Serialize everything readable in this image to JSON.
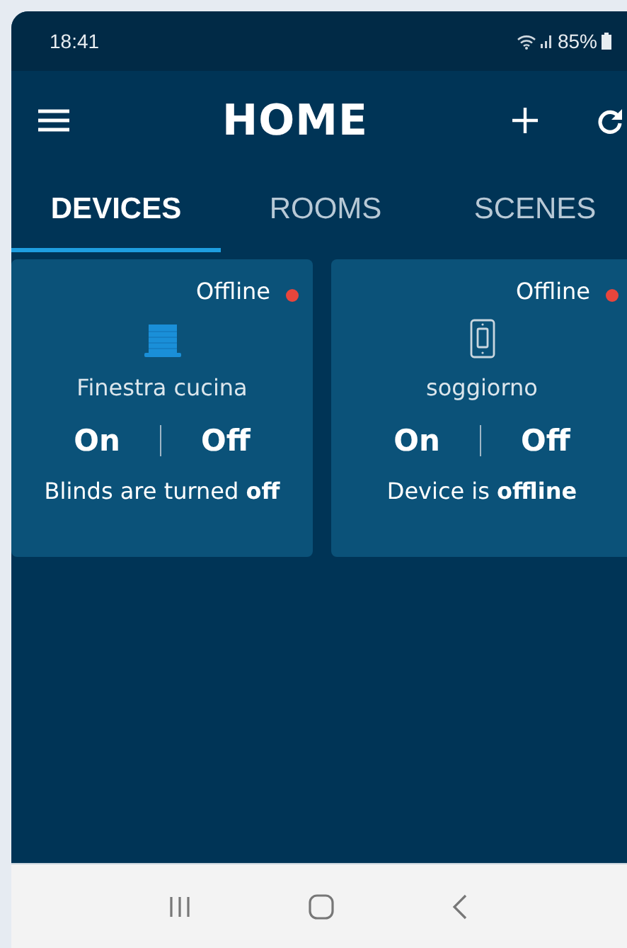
{
  "status_bar": {
    "time": "18:41",
    "battery": "85%"
  },
  "app_bar": {
    "title": "HOME"
  },
  "tabs": [
    {
      "label": "DEVICES",
      "selected": true
    },
    {
      "label": "ROOMS",
      "selected": false
    },
    {
      "label": "SCENES",
      "selected": false
    }
  ],
  "devices": [
    {
      "kind": "blinds",
      "status": "Offline",
      "color": "#e8453c",
      "name": "Finestra cucina",
      "on_label": "On",
      "off_label": "Off",
      "description": "Blinds are turned **off**"
    },
    {
      "kind": "switch",
      "status": "Offline",
      "color": "#e8453c",
      "name": "soggiorno",
      "on_label": "On",
      "off_label": "Off",
      "description": "Device is **offline**"
    }
  ]
}
